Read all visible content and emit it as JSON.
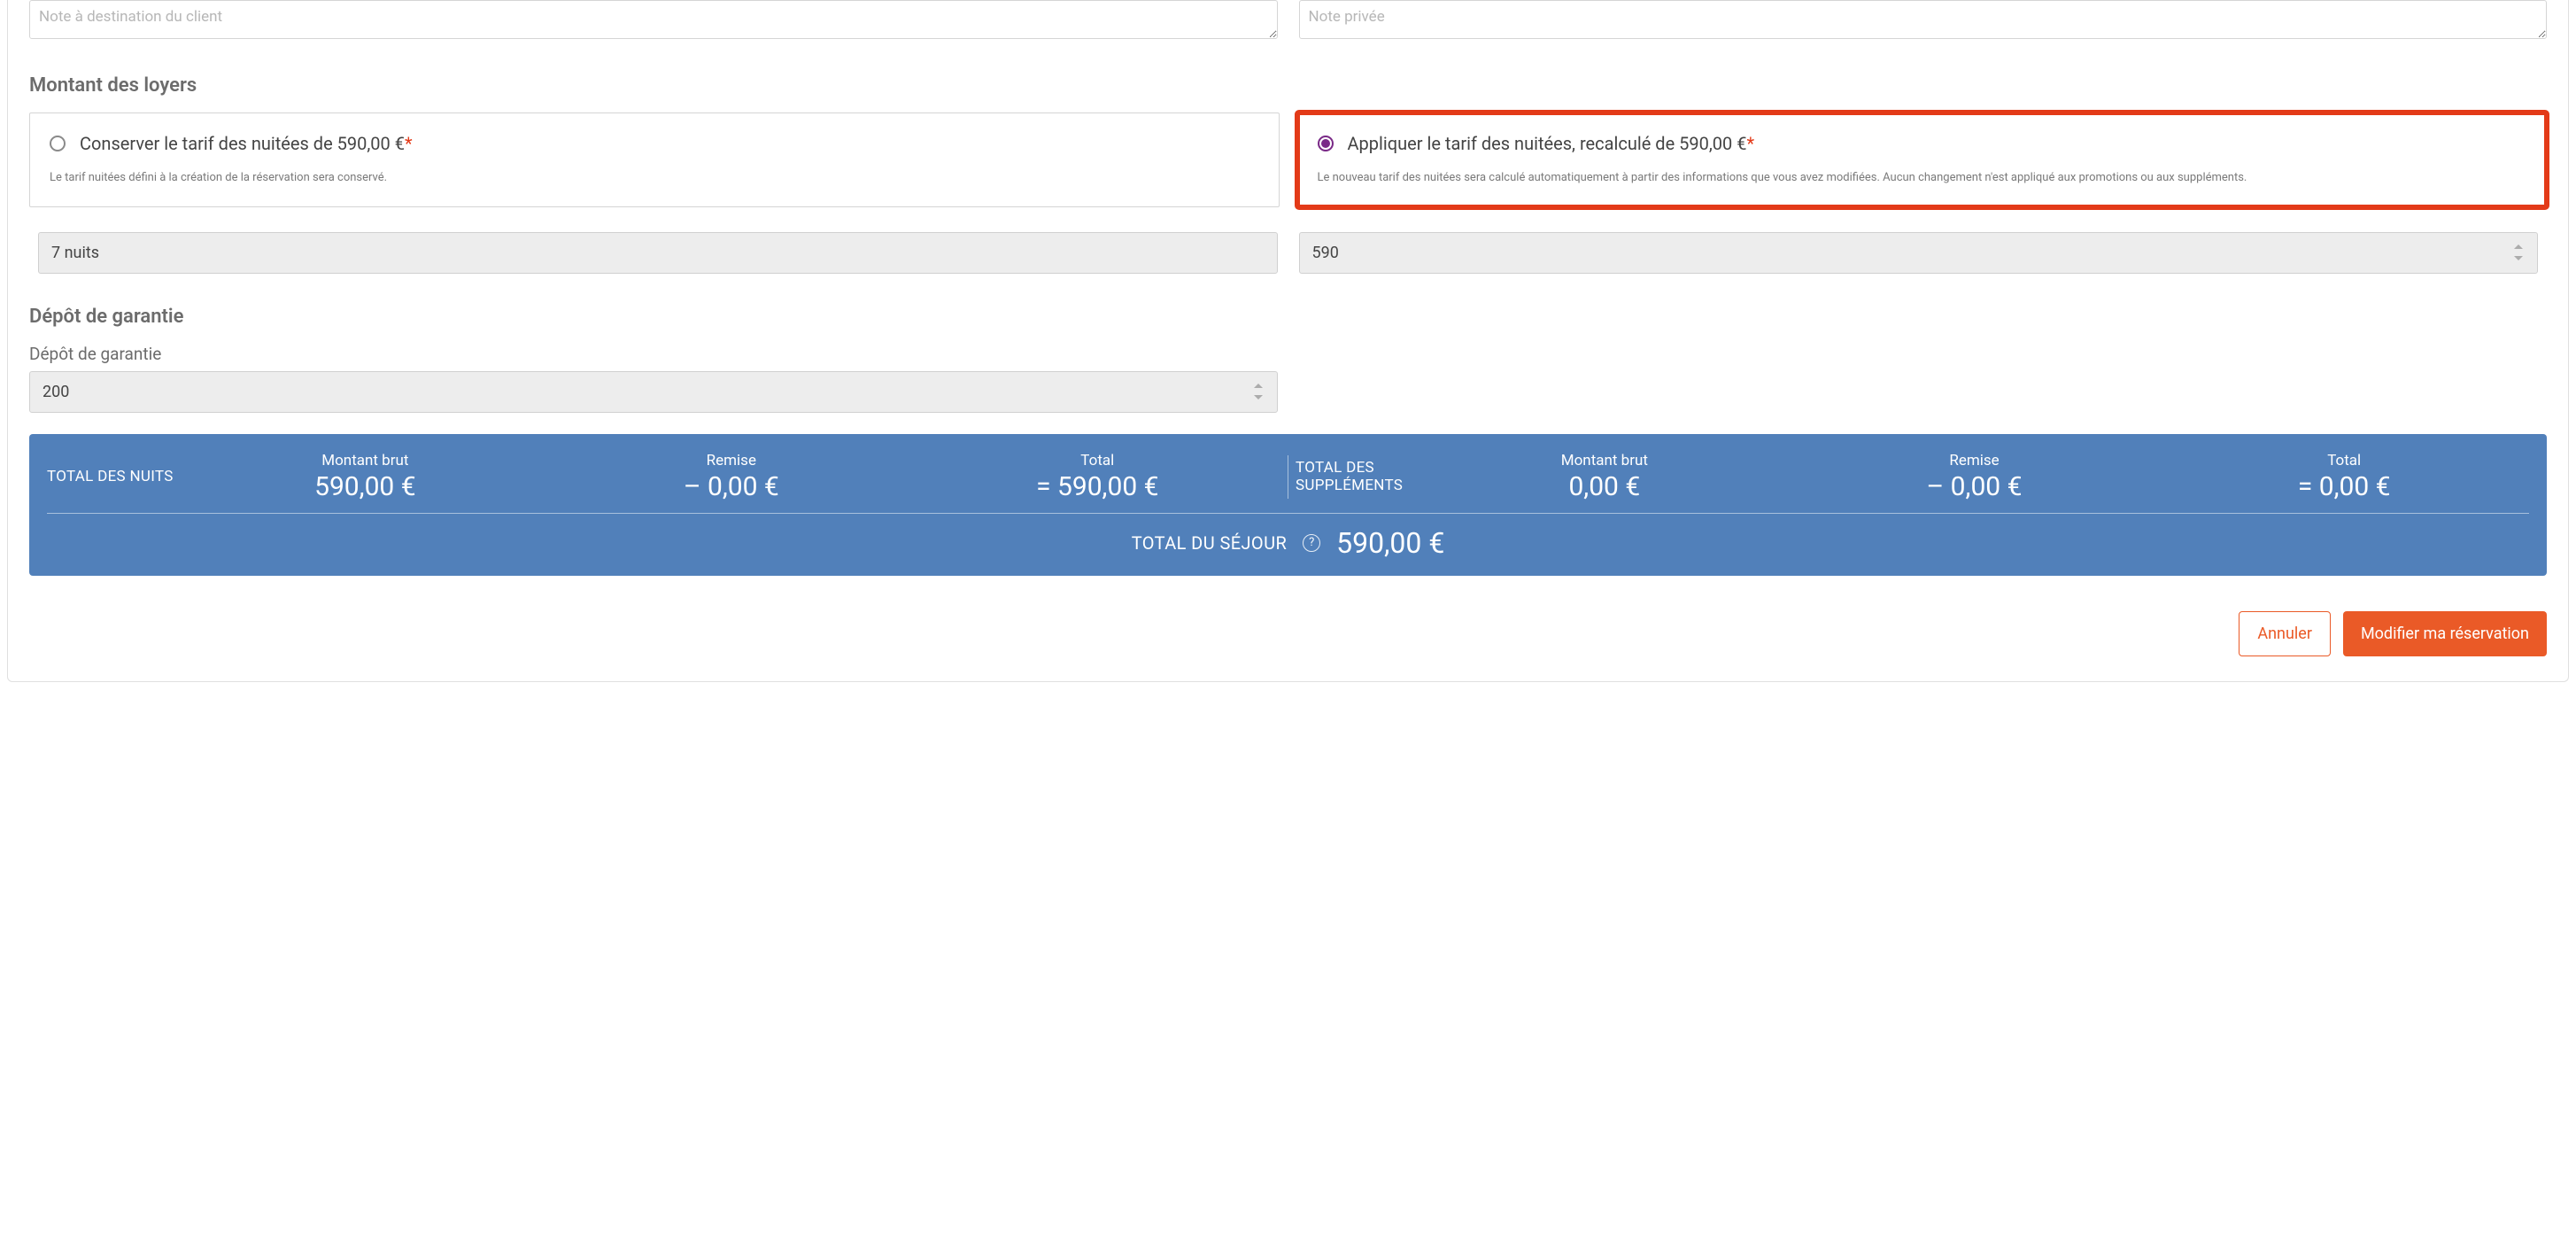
{
  "notes": {
    "client_placeholder": "Note à destination du client",
    "private_placeholder": "Note privée"
  },
  "rents": {
    "section_title": "Montant des loyers",
    "option_keep": {
      "label": "Conserver le tarif des nuitées de 590,00 €",
      "required_mark": "*",
      "description": "Le tarif nuitées défini à la création de la réservation sera conservé.",
      "selected": false
    },
    "option_apply": {
      "label": "Appliquer le tarif des nuitées, recalculé de 590,00 €",
      "required_mark": "*",
      "description": "Le nouveau tarif des nuitées sera calculé automatiquement à partir des informations que vous avez modifiées. Aucun changement n'est appliqué aux promotions ou aux suppléments.",
      "selected": true
    },
    "nights_field": "7 nuits",
    "amount_field": "590"
  },
  "deposit": {
    "section_title": "Dépôt de garantie",
    "field_label": "Dépôt de garantie",
    "value": "200"
  },
  "totals": {
    "nights_group_title": "TOTAL DES NUITS",
    "supplements_group_title": "TOTAL DES SUPPLÉMENTS",
    "gross_label": "Montant brut",
    "discount_label": "Remise",
    "total_label": "Total",
    "nights_gross": "590,00 €",
    "nights_discount": "– 0,00 €",
    "nights_total": "= 590,00 €",
    "supp_gross": "0,00 €",
    "supp_discount": "– 0,00 €",
    "supp_total": "= 0,00 €",
    "stay_label": "TOTAL DU SÉJOUR",
    "stay_value": "590,00 €",
    "help_glyph": "?"
  },
  "actions": {
    "cancel": "Annuler",
    "submit": "Modifier ma réservation"
  }
}
